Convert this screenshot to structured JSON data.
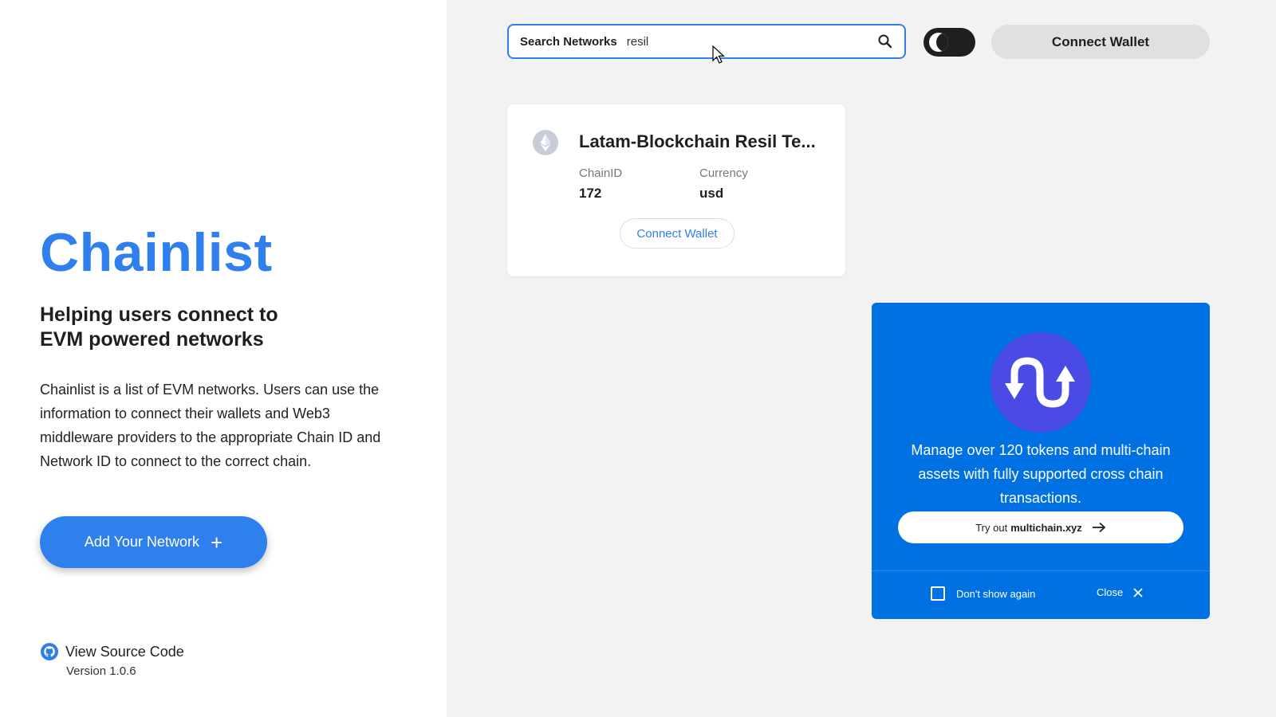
{
  "sidebar": {
    "brand": "Chainlist",
    "tagline_line1": "Helping users connect to",
    "tagline_line2": "EVM powered networks",
    "description": "Chainlist is a list of EVM networks. Users can use the information to connect their wallets and Web3 middleware providers to the appropriate Chain ID and Network ID to connect to the correct chain.",
    "add_network_label": "Add Your Network",
    "add_network_icon": "plus-icon",
    "source_label": "View Source Code",
    "source_icon": "github-icon",
    "version": "Version 1.0.6"
  },
  "header": {
    "search_label": "Search Networks",
    "search_value": "resil",
    "search_icon": "search-icon",
    "theme_toggle_icon": "moon-icon",
    "connect_wallet_label": "Connect Wallet"
  },
  "network_card": {
    "name": "Latam-Blockchain Resil Te...",
    "chain_id_label": "ChainID",
    "chain_id_value": "172",
    "currency_label": "Currency",
    "currency_value": "usd",
    "connect_label": "Connect Wallet",
    "logo_icon": "ethereum-icon"
  },
  "promo": {
    "text": "Manage over 120 tokens and multi-chain assets with fully supported cross chain transactions.",
    "cta_prefix": "Try out",
    "cta_link": "multichain.xyz",
    "dont_show_label": "Don't show again",
    "close_label": "Close",
    "colors": {
      "background": "#0071e3",
      "logo": "#4a4ae6"
    }
  },
  "colors": {
    "accent": "#2f80ed",
    "right_bg": "#f2f2f2"
  }
}
